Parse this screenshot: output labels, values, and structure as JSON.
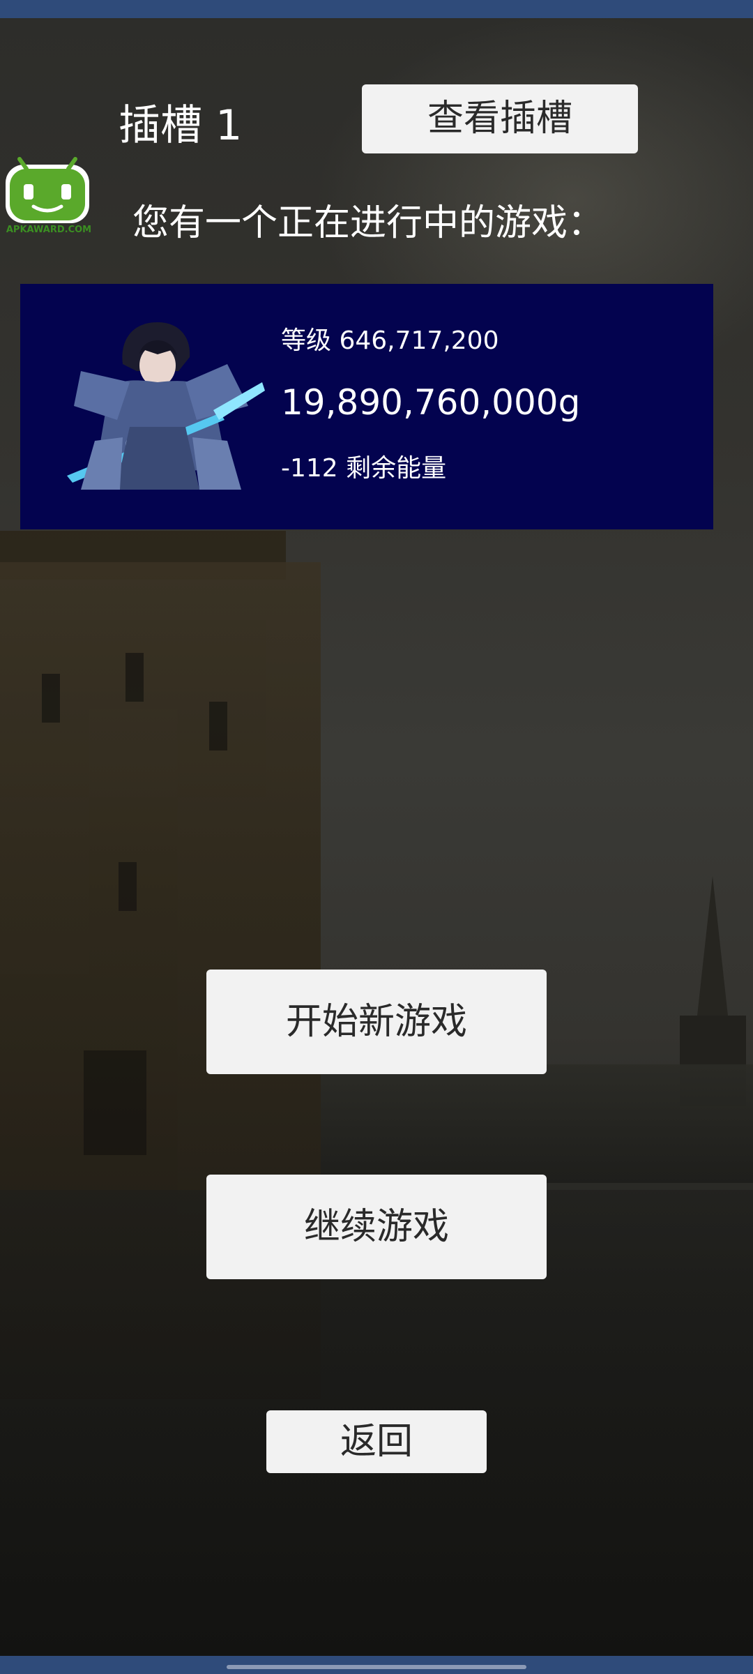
{
  "slot": {
    "title": "插槽 1",
    "view_slots_label": "查看插槽"
  },
  "message": "您有一个正在进行中的游戏：",
  "save_game": {
    "level_text": "等级 646,717,200",
    "gold_text": "19,890,760,000g",
    "energy_text": "-112 剩余能量"
  },
  "buttons": {
    "new_game": "开始新游戏",
    "continue": "继续游戏",
    "back": "返回"
  },
  "watermark": {
    "text": "APKAWARD.COM",
    "icon": "android-robot-icon"
  },
  "colors": {
    "card_background": "#03034f",
    "button_background": "#f2f2f2",
    "system_bar": "#2f4b7a"
  }
}
